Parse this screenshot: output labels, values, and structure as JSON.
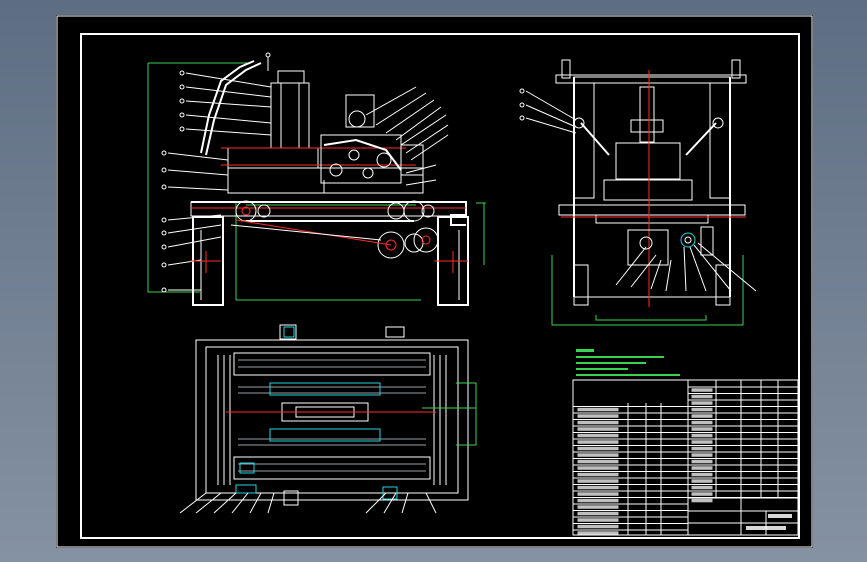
{
  "drawing": {
    "background": "#000000",
    "viewport_background": "#6f7d90",
    "line_colors": {
      "outline": "#ffffff",
      "dimension": "#39d353",
      "centerline": "#ff2a2a",
      "highlight": "#22d3e0",
      "hidden": "#9aa0a6"
    },
    "views": [
      "front-view",
      "side-view",
      "top-view"
    ],
    "has_technical_notes": true,
    "has_parts_list": true,
    "has_title_block": true
  }
}
